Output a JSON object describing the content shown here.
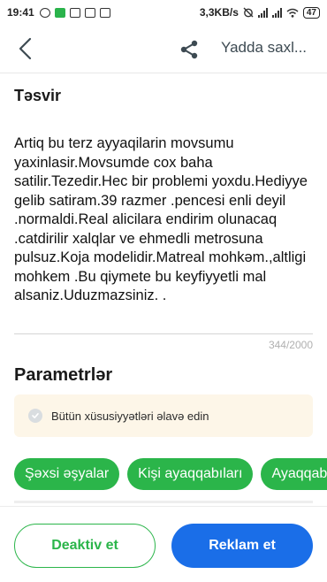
{
  "status_bar": {
    "time": "19:41",
    "speed": "3,3KB/s",
    "battery": "47"
  },
  "app_bar": {
    "back_icon": "chevron-left-icon",
    "share_icon": "share-icon",
    "save_label": "Yadda saxl..."
  },
  "description": {
    "title": "Təsvir",
    "text": "Artiq bu terz ayyaqilarin movsumu yaxinlasir.Movsumde cox baha satilir.Tezedir.Hec bir problemi yoxdu.Hediyye gelib satiram.39 razmer .pencesi enli deyil .normaldi.Real alicilara endirim olunacaq .catdirilir xalqlar ve ehmedli metrosuna pulsuz.Koja modelidir.Matreal mohkəm.,altligi mohkem .Bu qiymete bu keyfiyyetli mal alsaniz.Uduzmazsiniz. .",
    "counter": "344/2000"
  },
  "parameters": {
    "title": "Parametrlər",
    "notice": "Bütün xüsusiyyətləri əlavə edin",
    "chips": [
      "Şəxsi əşyalar",
      "Kişi ayaqqabıları",
      "Ayaqqabılar"
    ]
  },
  "actions": {
    "deactivate_label": "Deaktiv et",
    "advertise_label": "Reklam et"
  },
  "colors": {
    "green": "#2bb54a",
    "blue": "#1a6ee8",
    "notice_bg": "#fdf6e8"
  }
}
